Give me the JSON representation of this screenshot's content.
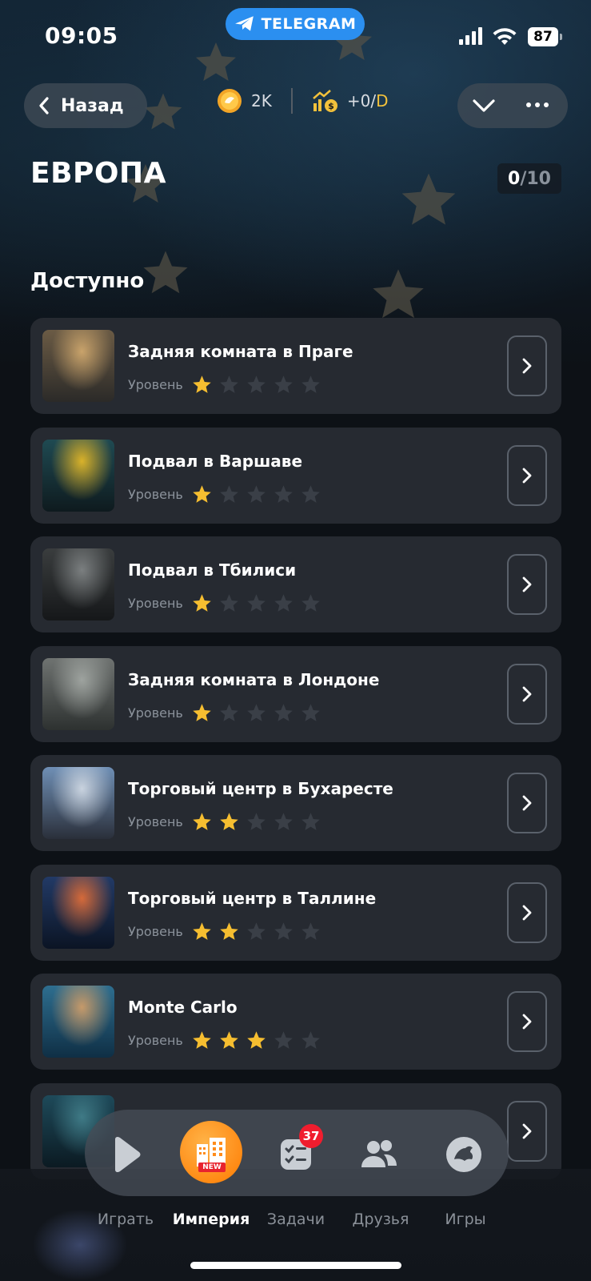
{
  "status_bar": {
    "time": "09:05",
    "telegram_label": "TELEGRAM",
    "battery": "87"
  },
  "header": {
    "back_label": "Назад",
    "coins": "2K",
    "income": "+0/",
    "income_unit": "D"
  },
  "page": {
    "title": "ЕВРОПА",
    "progress_current": "0",
    "progress_total": "/10",
    "section_title": "Доступно"
  },
  "level_label": "Уровень",
  "locations": [
    {
      "title": "Задняя комната в Праге",
      "stars": 1,
      "thumb_colors": [
        "#6b5b45",
        "#c9a36b",
        "#2b2a28"
      ]
    },
    {
      "title": "Подвал в Варшаве",
      "stars": 1,
      "thumb_colors": [
        "#1f4a52",
        "#d9b22a",
        "#0e1a1e"
      ]
    },
    {
      "title": "Подвал в Тбилиси",
      "stars": 1,
      "thumb_colors": [
        "#3a3d3e",
        "#7b7f80",
        "#151719"
      ]
    },
    {
      "title": "Задняя комната в Лондоне",
      "stars": 1,
      "thumb_colors": [
        "#6f7371",
        "#9ea39f",
        "#2d3130"
      ]
    },
    {
      "title": "Торговый центр в Бухаресте",
      "stars": 2,
      "thumb_colors": [
        "#6f8fb5",
        "#c9d3df",
        "#2a2f3a"
      ]
    },
    {
      "title": "Торговый центр в Таллине",
      "stars": 2,
      "thumb_colors": [
        "#223a66",
        "#d56a3a",
        "#0b1424"
      ]
    },
    {
      "title": "Monte Carlo",
      "stars": 3,
      "thumb_colors": [
        "#2e6e8f",
        "#c69a6a",
        "#0f2f45"
      ]
    },
    {
      "title": "",
      "stars": 0,
      "thumb_colors": [
        "#1e4a5a",
        "#3f7a86",
        "#0b1a22"
      ]
    }
  ],
  "max_stars": 5,
  "nav": {
    "items": [
      {
        "label": "Играть",
        "icon": "play-icon"
      },
      {
        "label": "Империя",
        "icon": "building-icon"
      },
      {
        "label": "Задачи",
        "icon": "tasks-icon"
      },
      {
        "label": "Друзья",
        "icon": "friends-icon"
      },
      {
        "label": "Игры",
        "icon": "games-icon"
      }
    ],
    "new_tag": "NEW",
    "tasks_badge": "37"
  },
  "colors": {
    "accent": "#f6be30",
    "card": "#262a31",
    "telegram": "#2b8ff0",
    "badge": "#f01d2e",
    "empire": "#ff8c1a"
  }
}
